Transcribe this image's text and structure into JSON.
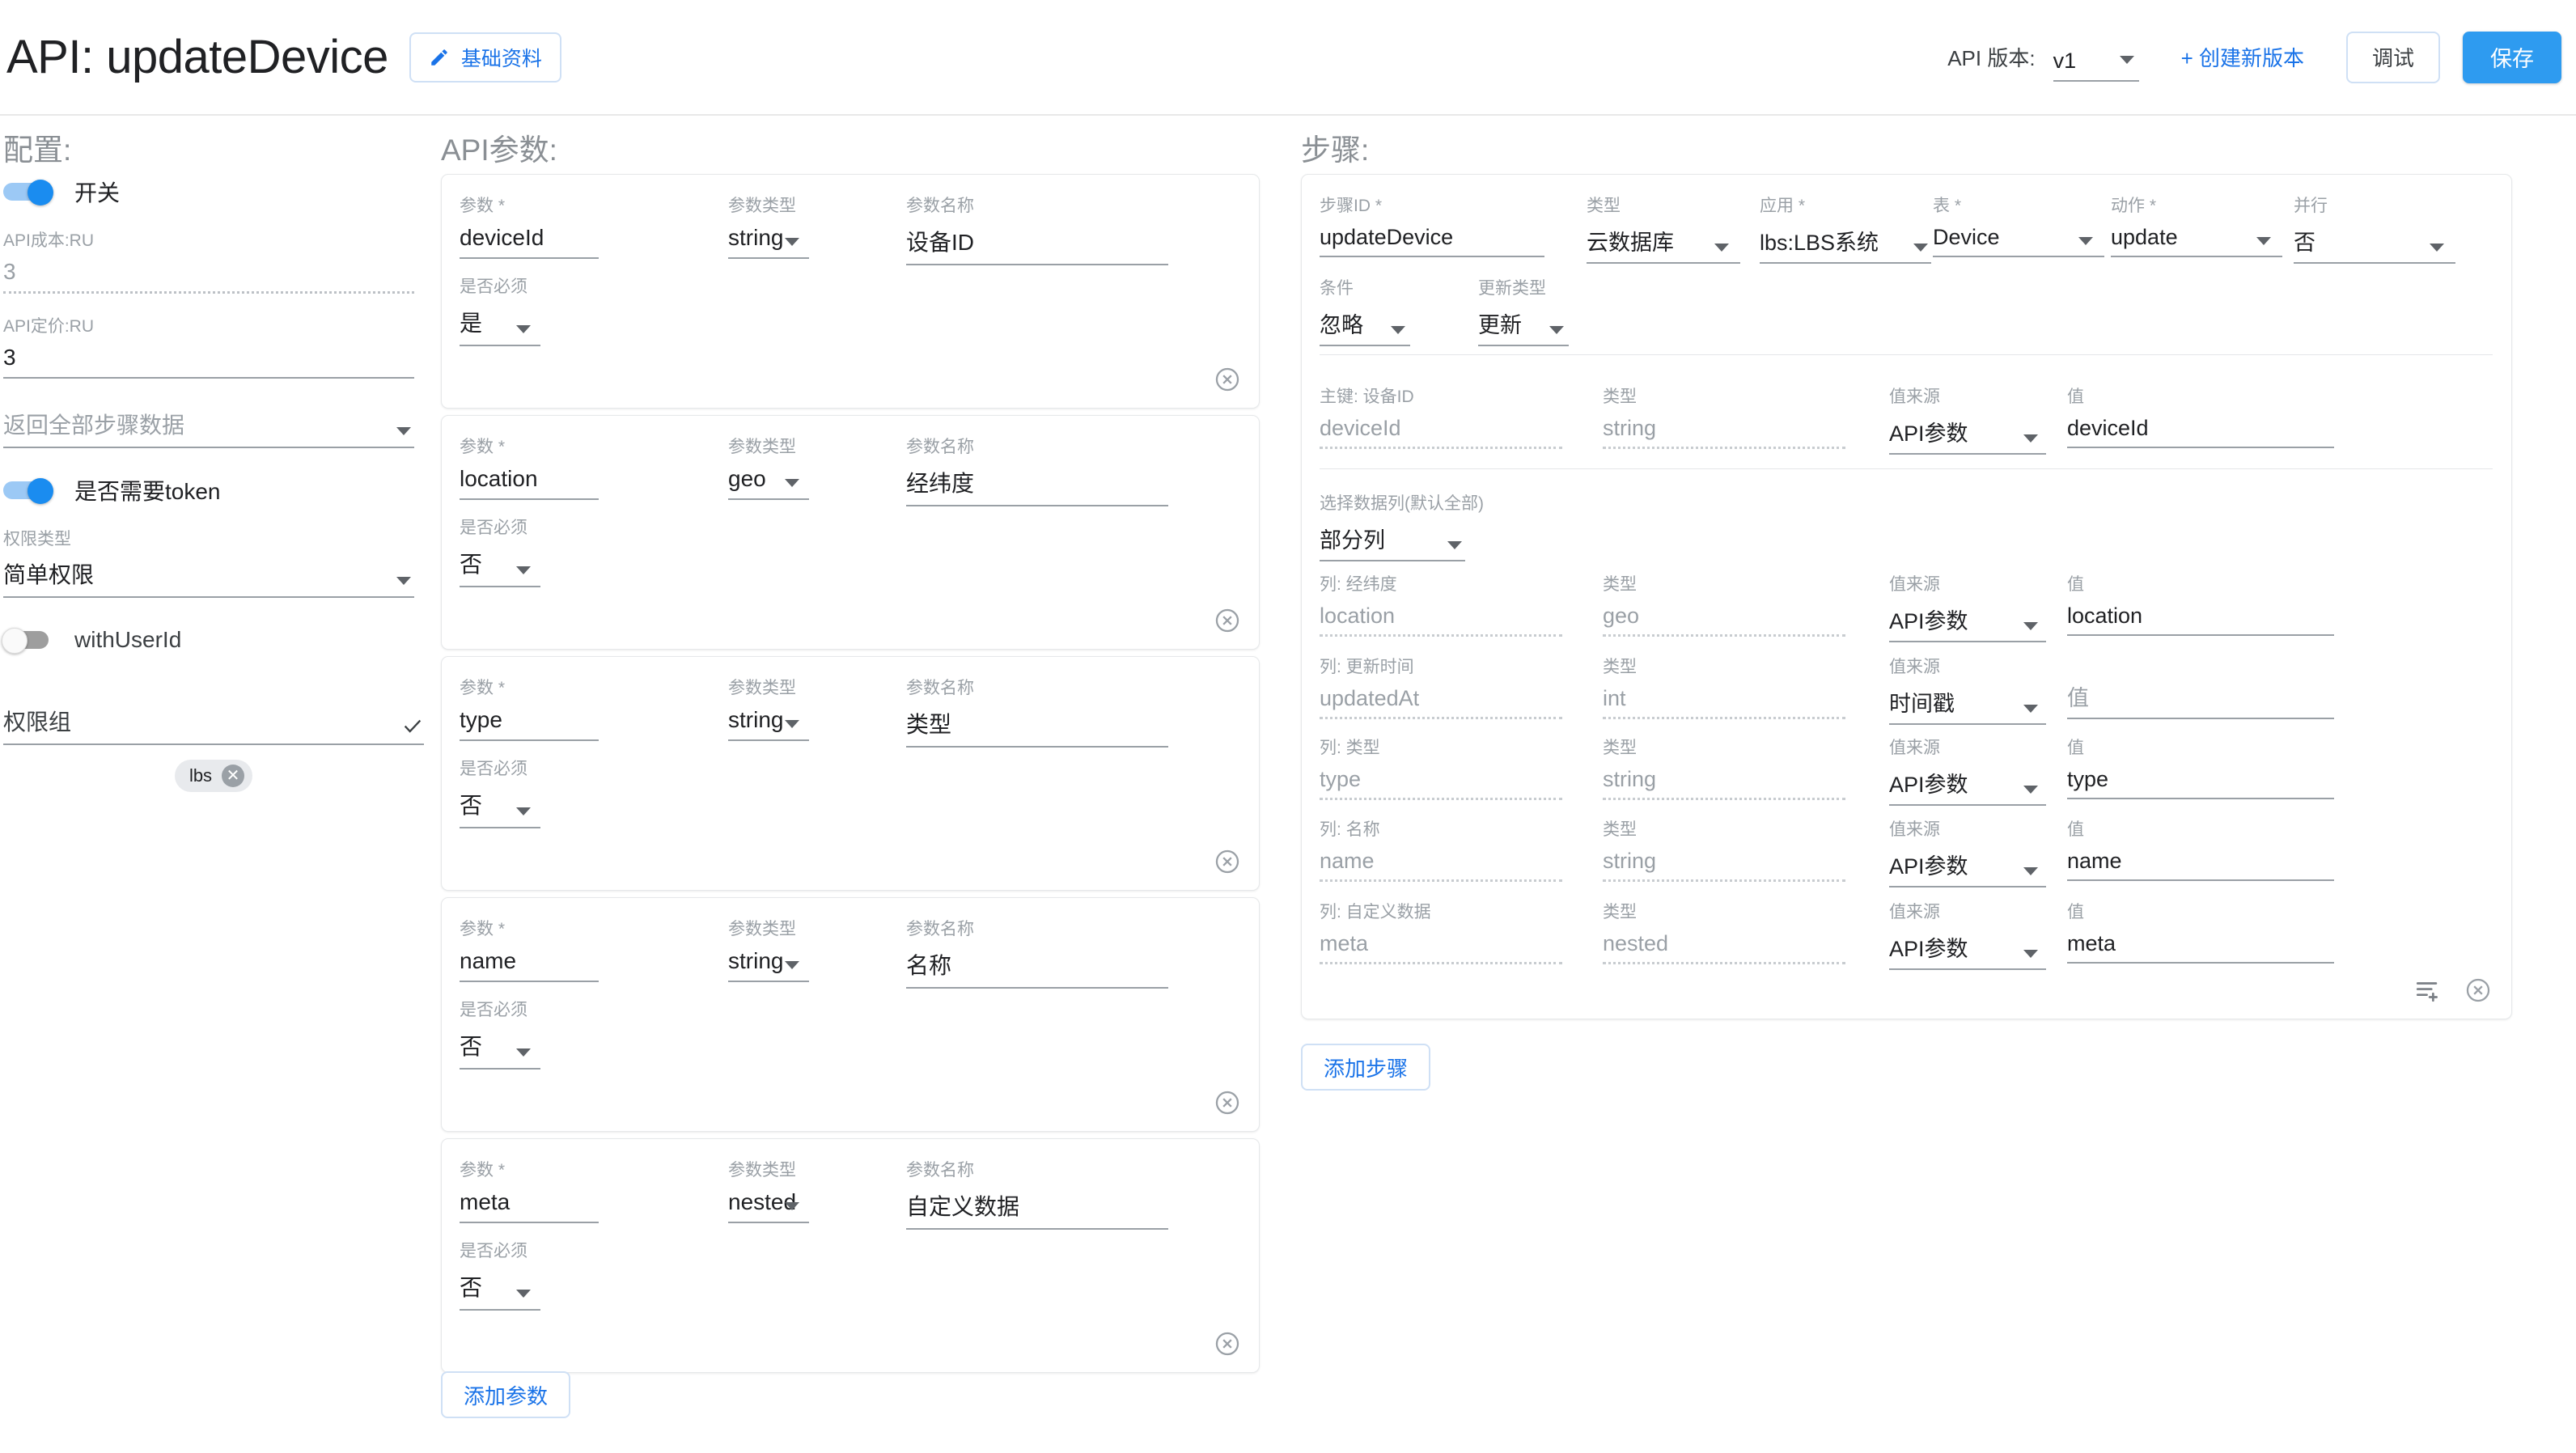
{
  "header": {
    "title": "API: updateDevice",
    "basic_info_button": "基础资料",
    "pencil_icon": "pencil-icon",
    "version_label": "API 版本:",
    "version_value": "v1",
    "create_version_button": "+ 创建新版本",
    "debug_button": "调试",
    "save_button": "保存",
    "accent_color": "#1a73e8",
    "save_color": "#2e9bf0"
  },
  "config": {
    "title": "配置:",
    "enabled_toggle": {
      "label": "开关",
      "state": "on"
    },
    "api_cost": {
      "label": "API成本:RU",
      "value": "3",
      "is_placeholder": true
    },
    "api_price": {
      "label": "API定价:RU",
      "value": "3",
      "is_placeholder": false
    },
    "return_all_steps": {
      "value": "返回全部步骤数据"
    },
    "token_toggle": {
      "label": "是否需要token",
      "state": "on"
    },
    "auth_type": {
      "label": "权限类型",
      "value": "简单权限"
    },
    "with_user_id_toggle": {
      "label": "withUserId",
      "state": "off"
    },
    "permission_group": {
      "label": "权限组",
      "check_icon": "check-icon",
      "chips": [
        {
          "label": "lbs"
        }
      ]
    }
  },
  "params": {
    "title": "API参数:",
    "labels": {
      "param": "参数 *",
      "type": "参数类型",
      "name": "参数名称",
      "required": "是否必须"
    },
    "add_button": "添加参数",
    "items": [
      {
        "param": "deviceId",
        "type": "string",
        "name": "设备ID",
        "required": "是"
      },
      {
        "param": "location",
        "type": "geo",
        "name": "经纬度",
        "required": "否"
      },
      {
        "param": "type",
        "type": "string",
        "name": "类型",
        "required": "否"
      },
      {
        "param": "name",
        "type": "string",
        "name": "名称",
        "required": "否"
      },
      {
        "param": "meta",
        "type": "nested",
        "name": "自定义数据",
        "required": "否"
      }
    ]
  },
  "steps": {
    "title": "步骤:",
    "add_button": "添加步骤",
    "labels": {
      "step_id": "步骤ID *",
      "type": "类型",
      "app": "应用 *",
      "table": "表 *",
      "action": "动作 *",
      "parallel": "并行",
      "condition": "条件",
      "update_type": "更新类型",
      "col_type": "类型",
      "value_source": "值来源",
      "value": "值",
      "select_columns": "选择数据列(默认全部)"
    },
    "step": {
      "step_id": "updateDevice",
      "type": "云数据库",
      "app": "lbs:LBS系统",
      "table": "Device",
      "action": "update",
      "parallel": "否",
      "condition": "忽略",
      "update_type": "更新",
      "select_columns_value": "部分列",
      "primary_key": {
        "label": "主键: 设备ID",
        "field": "deviceId",
        "type": "string",
        "value_source": "API参数",
        "value": "deviceId"
      },
      "columns": [
        {
          "label": "列: 经纬度",
          "field": "location",
          "type": "geo",
          "value_source": "API参数",
          "value": "location",
          "value_is_placeholder": false
        },
        {
          "label": "列: 更新时间",
          "field": "updatedAt",
          "type": "int",
          "value_source": "时间戳",
          "value": "值",
          "value_is_placeholder": true
        },
        {
          "label": "列: 类型",
          "field": "type",
          "type": "string",
          "value_source": "API参数",
          "value": "type",
          "value_is_placeholder": false
        },
        {
          "label": "列: 名称",
          "field": "name",
          "type": "string",
          "value_source": "API参数",
          "value": "name",
          "value_is_placeholder": false
        },
        {
          "label": "列: 自定义数据",
          "field": "meta",
          "type": "nested",
          "value_source": "API参数",
          "value": "meta",
          "value_is_placeholder": false
        }
      ],
      "icons": {
        "add_row": "list-add-icon",
        "delete": "delete-circle-icon"
      }
    }
  }
}
